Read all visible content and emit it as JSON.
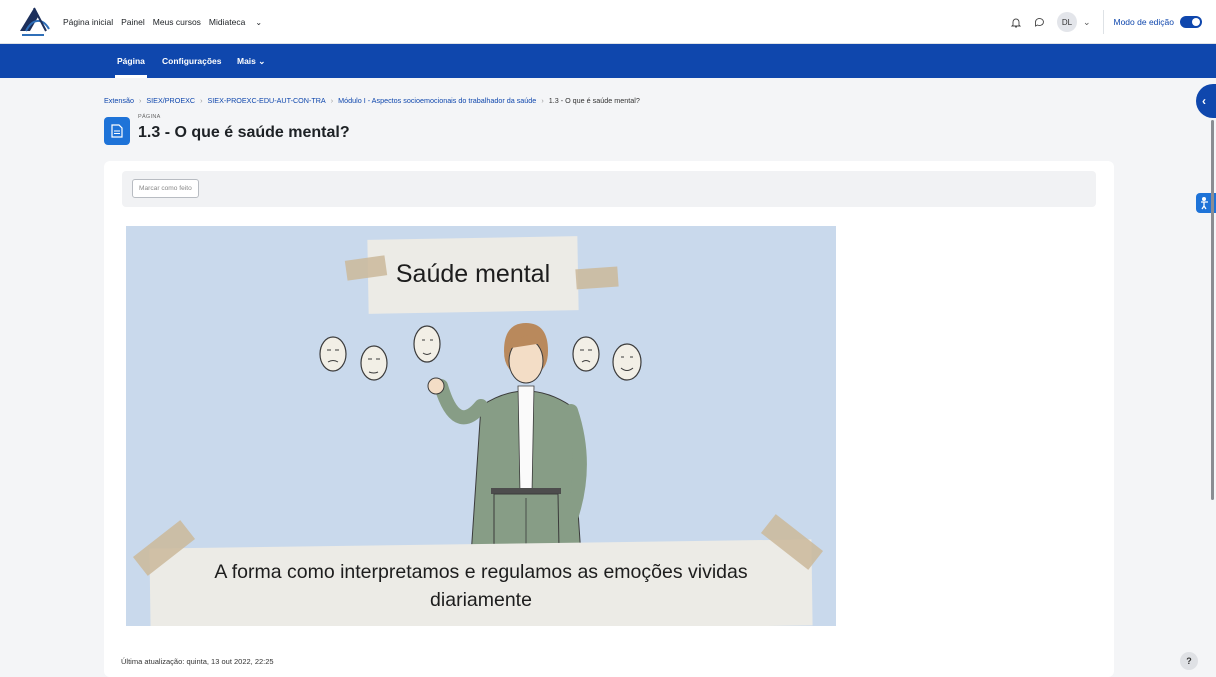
{
  "topnav": {
    "logo_name": "ucead-logo",
    "links": [
      "Página inicial",
      "Painel",
      "Meus cursos",
      "Midiateca"
    ],
    "notifications_icon": "bell-icon",
    "messages_icon": "chat-bubble-icon",
    "user_initials": "DL",
    "edit_mode_label": "Modo de edição",
    "edit_mode_on": true
  },
  "secnav": {
    "tabs": [
      "Página",
      "Configurações",
      "Mais"
    ],
    "active_tab": "Página"
  },
  "breadcrumb": [
    "Extensão",
    "SIEX/PROEXC",
    "SIEX-PROEXC-EDU-AUT-CON-TRA",
    "Módulo I - Aspectos socioemocionais do trabalhador da saúde",
    "1.3 - O que é saúde mental?"
  ],
  "header": {
    "kind": "PÁGINA",
    "title": "1.3 - O que é saúde mental?"
  },
  "completion": {
    "button_label": "Marcar como feito"
  },
  "illustration": {
    "title_text": "Saúde mental",
    "caption_line1": "A forma como interpretamos e regulamos as emoções vividas",
    "caption_line2": "diariamente"
  },
  "footer": {
    "last_updated": "Última atualização: quinta, 13 out 2022, 22:25"
  },
  "help": {
    "label": "?"
  },
  "colors": {
    "brand_blue": "#0f47ad",
    "accent_blue": "#1e73d8",
    "illustration_bg": "#c9d9ec"
  }
}
